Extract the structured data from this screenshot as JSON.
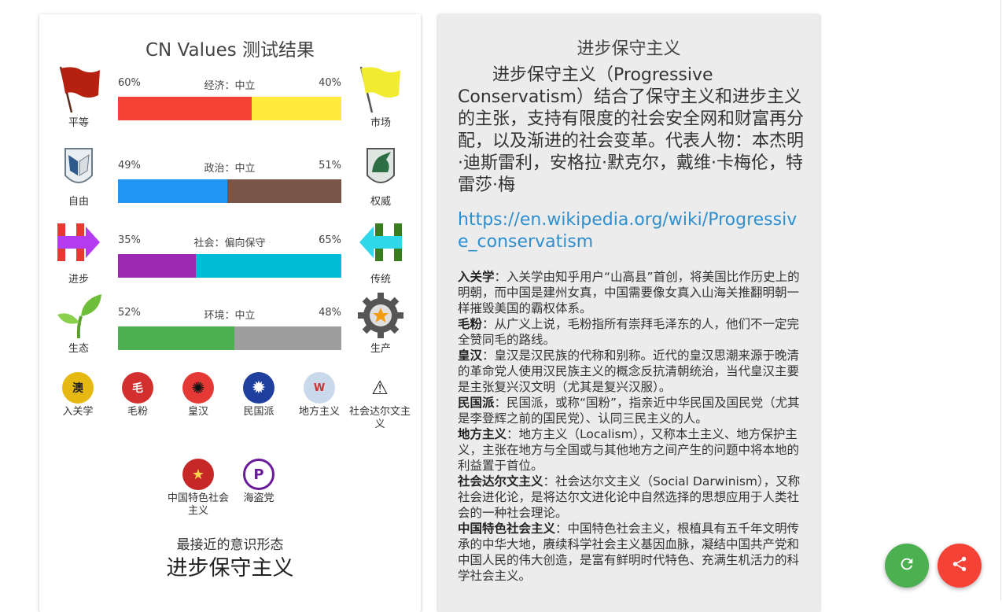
{
  "left": {
    "title": "CN Values 测试结果",
    "axes": [
      {
        "left_pct": "60%",
        "right_pct": "40%",
        "label": "经济：中立",
        "left_label": "平等",
        "right_label": "市场",
        "left_value": 0.6,
        "left_color": "#f44336",
        "right_color": "#ffeb3b",
        "left_icon": "red-flag-icon",
        "right_icon": "yellow-flag-icon"
      },
      {
        "left_pct": "49%",
        "right_pct": "51%",
        "label": "政治：中立",
        "left_label": "自由",
        "right_label": "权威",
        "left_value": 0.49,
        "left_color": "#2196f3",
        "right_color": "#795548",
        "left_icon": "wings-emblem-icon",
        "right_icon": "unicorn-shield-icon"
      },
      {
        "left_pct": "35%",
        "right_pct": "65%",
        "label": "社会：偏向保守",
        "left_label": "进步",
        "right_label": "传统",
        "left_value": 0.35,
        "left_color": "#9c27b0",
        "right_color": "#00bcd4",
        "left_icon": "right-arrow-icon",
        "right_icon": "left-arrow-icon"
      },
      {
        "left_pct": "52%",
        "right_pct": "48%",
        "label": "环境：中立",
        "left_label": "生态",
        "right_label": "生产",
        "left_value": 0.52,
        "left_color": "#4caf50",
        "right_color": "#9e9e9e",
        "left_icon": "sprout-icon",
        "right_icon": "gear-icon"
      }
    ],
    "ideologies": [
      {
        "label": "入关学",
        "glyph": "澳",
        "color": "#e6b812"
      },
      {
        "label": "毛粉",
        "glyph": "毛",
        "color": "#d32f2f"
      },
      {
        "label": "皇汉",
        "glyph": "✺",
        "color": "#e53935"
      },
      {
        "label": "民国派",
        "glyph": "✹",
        "color": "#1e3f9e"
      },
      {
        "label": "地方主义",
        "glyph": "W",
        "color": "#9bb6d6"
      },
      {
        "label": "社会达尔文主义",
        "glyph": "⚠",
        "color": "#ffffff"
      },
      {
        "label": "中国特色社会主义",
        "glyph": "★",
        "color": "#c62828"
      },
      {
        "label": "海盗党",
        "glyph": "P",
        "color": "#ffffff"
      }
    ],
    "closest_caption": "最接近的意识形态",
    "closest_value": "进步保守主义"
  },
  "right": {
    "title": "进步保守主义",
    "description": "进步保守主义（Progressive Conservatism）结合了保守主义和进步主义的主张，支持有限度的社会安全网和财富再分配，以及渐进的社会变革。代表人物：本杰明·迪斯雷利，安格拉·默克尔，戴维·卡梅伦，特雷莎·梅",
    "link": "https://en.wikipedia.org/wiki/Progressive_conservatism",
    "notes": [
      {
        "term": "入关学",
        "text": "：入关学由知乎用户“山高县”首创，将美国比作历史上的明朝，而中国是建州女真，中国需要像女真入山海关推翻明朝一样摧毁美国的霸权体系。"
      },
      {
        "term": "毛粉",
        "text": "：从广义上说，毛粉指所有崇拜毛泽东的人，他们不一定完全赞同毛的路线。"
      },
      {
        "term": "皇汉",
        "text": "：皇汉是汉民族的代称和别称。近代的皇汉思潮来源于晚清的革命党人使用汉民族主义的概念反抗清朝统治，当代皇汉主要是主张复兴汉文明（尤其是复兴汉服）。"
      },
      {
        "term": "民国派",
        "text": "：民国派，或称“国粉”，指亲近中华民国及国民党（尤其是李登辉之前的国民党）、认同三民主义的人。"
      },
      {
        "term": "地方主义",
        "text": "：地方主义（Localism），又称本土主义、地方保护主义，主张在地方与全国或与其他地方之间产生的问题中将本地的利益置于首位。"
      },
      {
        "term": "社会达尔文主义",
        "text": "：社会达尔文主义（Social Darwinism），又称社会进化论，是将达尔文进化论中自然选择的思想应用于人类社会的一种社会理论。"
      },
      {
        "term": "中国特色社会主义",
        "text": "：中国特色社会主义，根植具有五千年文明传承的中华大地，赓续科学社会主义基因血脉，凝结中国共产党和中国人民的伟大创造，是富有鲜明时代特色、充满生机活力的科学社会主义。"
      }
    ]
  },
  "fabs": {
    "refresh_icon": "refresh-icon",
    "share_icon": "share-icon"
  }
}
